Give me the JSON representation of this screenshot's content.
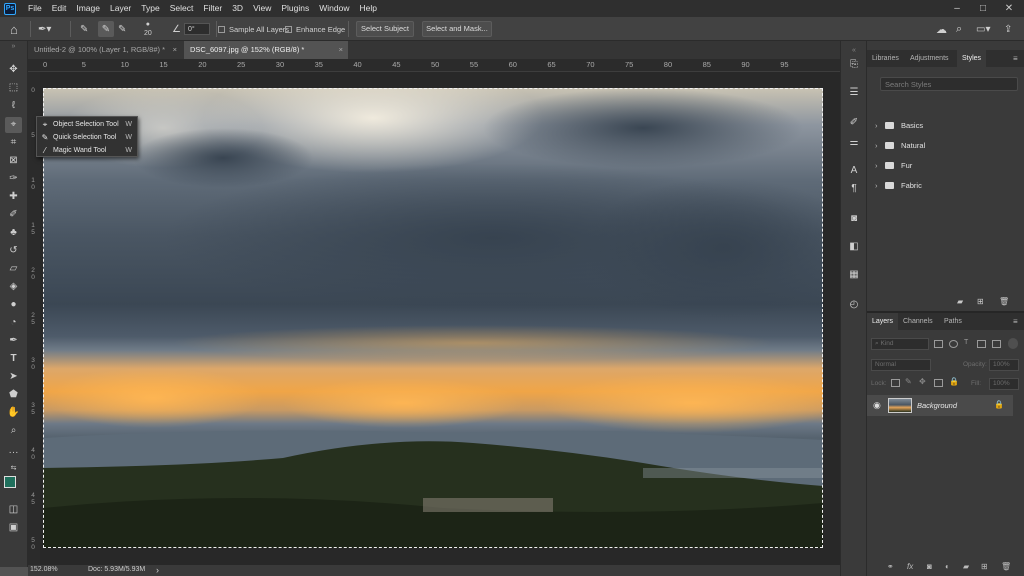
{
  "app": {
    "logo": "Ps",
    "menu": [
      "File",
      "Edit",
      "Image",
      "Layer",
      "Type",
      "Select",
      "Filter",
      "3D",
      "View",
      "Plugins",
      "Window",
      "Help"
    ]
  },
  "options": {
    "brush_size": "20",
    "angle": "0°",
    "sample_all_layers": "Sample All Layers",
    "enhance_edge": "Enhance Edge",
    "select_subject": "Select Subject",
    "select_and_mask": "Select and Mask..."
  },
  "tabs": [
    {
      "label": "Untitled-2 @ 100% (Layer 1, RGB/8#) *",
      "close": "×"
    },
    {
      "label": "DSC_6097.jpg @ 152% (RGB/8) *",
      "close": "×"
    }
  ],
  "ruler": {
    "top": [
      "0",
      "5",
      "10",
      "15",
      "20",
      "25",
      "30",
      "35",
      "40",
      "45",
      "50",
      "55",
      "60",
      "65",
      "70",
      "75",
      "80",
      "85",
      "90",
      "95"
    ],
    "left": [
      "0",
      "5",
      "1 0",
      "1 5",
      "2 0",
      "2 5",
      "3 0",
      "3 5",
      "4 0",
      "4 5",
      "5 0"
    ]
  },
  "flyout": {
    "items": [
      {
        "label": "Object Selection Tool",
        "key": "W"
      },
      {
        "label": "Quick Selection Tool",
        "key": "W"
      },
      {
        "label": "Magic Wand Tool",
        "key": "W"
      }
    ]
  },
  "status": {
    "zoom": "152.08%",
    "doc": "Doc: 5.93M/5.93M",
    "arrow": "›"
  },
  "styles_panel": {
    "tabs": [
      "Libraries",
      "Adjustments",
      "Styles"
    ],
    "search_placeholder": "Search Styles",
    "groups": [
      "Basics",
      "Natural",
      "Fur",
      "Fabric"
    ]
  },
  "layers_panel": {
    "tabs": [
      "Layers",
      "Channels",
      "Paths"
    ],
    "kind_label": "Kind",
    "blend_mode": "Normal",
    "opacity_label": "Opacity:",
    "opacity_value": "100%",
    "lock_label": "Lock:",
    "fill_label": "Fill:",
    "fill_value": "100%",
    "layer_name": "Background"
  },
  "colors": {
    "foreground": "#1f6f5c",
    "background": "#000000",
    "accent": "#31a8ff"
  }
}
